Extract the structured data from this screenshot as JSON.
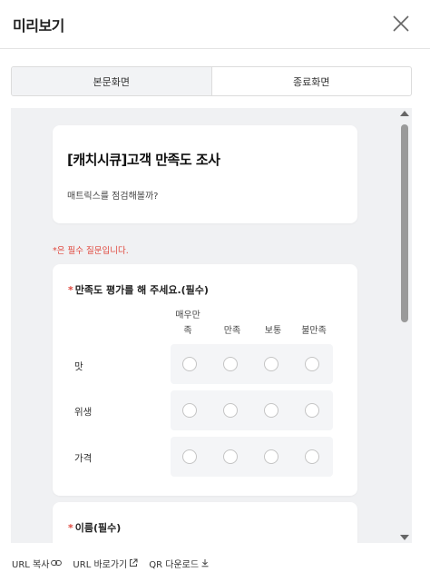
{
  "header": {
    "title": "미리보기"
  },
  "tabs": [
    {
      "label": "본문화면",
      "active": true
    },
    {
      "label": "종료화면",
      "active": false
    }
  ],
  "survey": {
    "title": "[캐치시큐]고객 만족도 조사",
    "description": "매트릭스를 점검해볼까?"
  },
  "required_note": "*은 필수 질문입니다.",
  "question1": {
    "star": "*",
    "label": "만족도 평가를 해 주세요.(필수)",
    "columns": [
      "매우만족",
      "만족",
      "보통",
      "불만족"
    ],
    "rows": [
      "맛",
      "위생",
      "가격"
    ]
  },
  "question2": {
    "star": "*",
    "label": "이름(필수)"
  },
  "footer": {
    "copy_url": "URL 복사",
    "open_url": "URL 바로가기",
    "qr_download": "QR 다운로드"
  },
  "colors": {
    "accent": "#e0483e",
    "preview_bg": "#f0f1f3"
  }
}
